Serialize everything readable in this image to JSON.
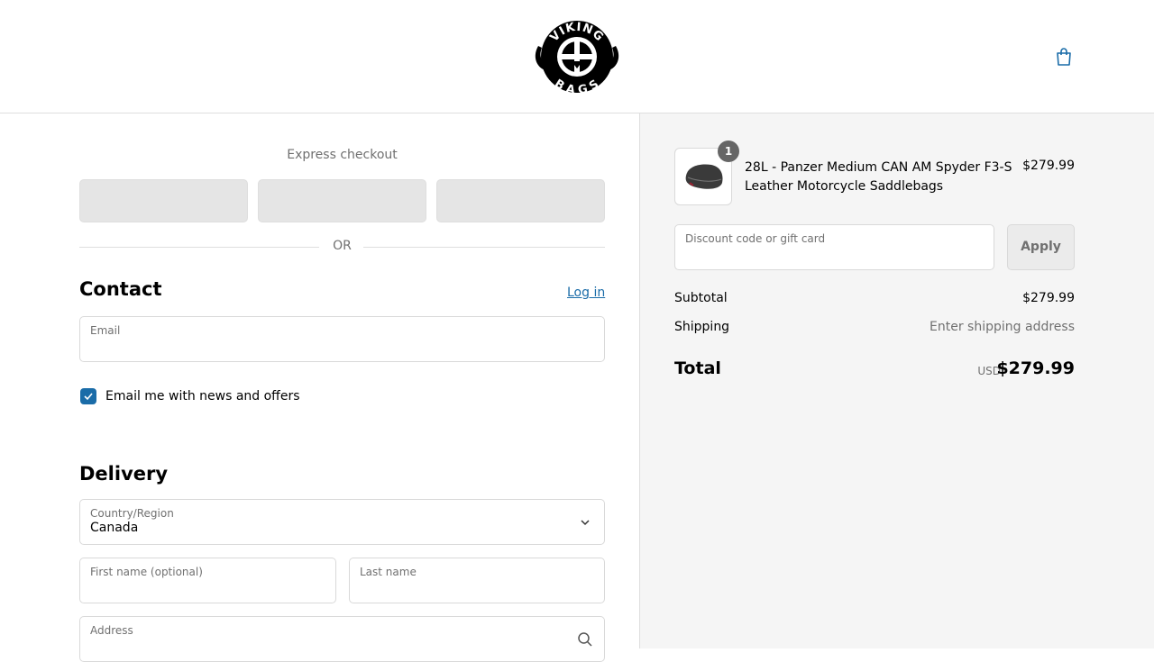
{
  "brand": {
    "logo_top": "VIKING",
    "logo_bottom": "BAGS"
  },
  "express": {
    "title": "Express checkout",
    "or_label": "OR"
  },
  "contact": {
    "title": "Contact",
    "login_label": "Log in",
    "email_label": "Email",
    "email_value": "",
    "newsletter_label": "Email me with news and offers",
    "newsletter_checked": true
  },
  "delivery": {
    "title": "Delivery",
    "country_label": "Country/Region",
    "country_value": "Canada",
    "first_name_label": "First name (optional)",
    "last_name_label": "Last name",
    "address_label": "Address"
  },
  "summary": {
    "product": {
      "quantity": "1",
      "name": "28L - Panzer Medium CAN AM Spyder F3-S Leather Motorcycle Saddlebags",
      "price": "$279.99"
    },
    "discount_label": "Discount code or gift card",
    "apply_label": "Apply",
    "subtotal_label": "Subtotal",
    "subtotal_value": "$279.99",
    "shipping_label": "Shipping",
    "shipping_value": "Enter shipping address",
    "total_label": "Total",
    "currency": "USD",
    "total_value": "$279.99"
  },
  "colors": {
    "accent": "#1a6ca8",
    "sidebar_bg": "#f5f5f5",
    "border": "#d9d9d9"
  }
}
